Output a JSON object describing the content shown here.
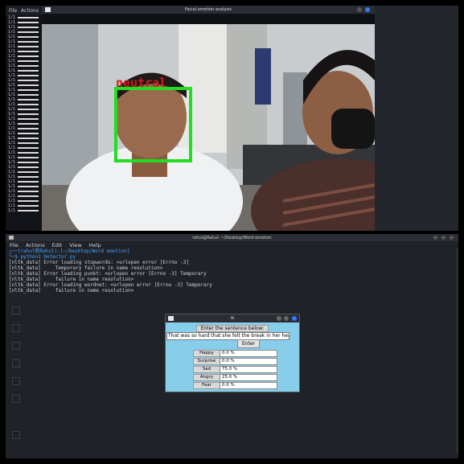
{
  "left_terminal": {
    "menu": [
      "File",
      "Actions"
    ],
    "row_prefix": [
      "1/1",
      "1/1",
      "1/1",
      "1/1",
      "1/1",
      "1/1",
      "1/1",
      "1/1",
      "1/1",
      "1/1",
      "1/1",
      "1/1",
      "1/1",
      "1/1",
      "1/1",
      "1/1",
      "1/1",
      "1/1",
      "1/1",
      "1/1",
      "1/1",
      "1/1",
      "1/1",
      "1/1",
      "1/1",
      "1/1",
      "1/1",
      "1/1",
      "1/1",
      "1/1",
      "1/1",
      "1/1",
      "1/1",
      "1/1",
      "1/1",
      "1/1",
      "1/1",
      "1/1",
      "1/1",
      "1/1",
      "1/1"
    ]
  },
  "video_window": {
    "title": "Facial emotion analysis",
    "detection_label": "neutral",
    "box_color": "#22dd22",
    "label_color": "#d11a1a"
  },
  "bottom_terminal": {
    "title": "rahul@Rahul: ~/Desktop/Word emotion",
    "menu": [
      "File",
      "Actions",
      "Edit",
      "View",
      "Help"
    ],
    "lines": [
      "┌──(rahul㉿Rahul)-[~/Desktop/Word emotion]",
      "└─$ python3 Detector.py",
      "[nltk_data] Error loading stopwords: <urlopen error [Errno -3]",
      "[nltk_data]     Temporary failure in name resolution>",
      "[nltk_data] Error loading punkt: <urlopen error [Errno -3] Temporary",
      "[nltk_data]     failure in name resolution>",
      "[nltk_data] Error loading wordnet: <urlopen error [Errno -3] Temporary",
      "[nltk_data]     failure in name resolution>"
    ]
  },
  "tk_dialog": {
    "title": "tk",
    "prompt_label": "Enter the sentence below:",
    "sentence_value": "That was so hard that she felt the break in her heart",
    "enter_button": "Enter",
    "emotions": [
      {
        "label": "Happy",
        "value": "0.0 %"
      },
      {
        "label": "Surprise",
        "value": "0.0 %"
      },
      {
        "label": "Sad",
        "value": "75.0 %"
      },
      {
        "label": "Angry",
        "value": "25.0 %"
      },
      {
        "label": "Fear",
        "value": "0.0 %"
      }
    ]
  }
}
